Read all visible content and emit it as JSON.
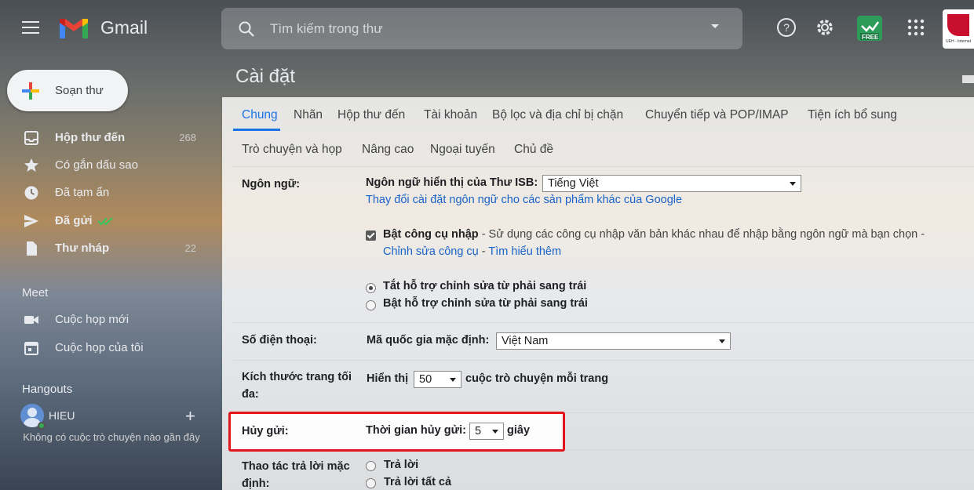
{
  "topbar": {
    "brand": "Gmail",
    "search_placeholder": "Tìm kiếm trong thư",
    "free_label": "FREE",
    "account_caption": "UEH - Internat"
  },
  "compose": {
    "label": "Soạn thư"
  },
  "nav": [
    {
      "label": "Hộp thư đến",
      "count": "268",
      "bold": true,
      "icon": "inbox-icon"
    },
    {
      "label": "Có gắn dấu sao",
      "count": "",
      "bold": false,
      "icon": "star-icon"
    },
    {
      "label": "Đã tạm ẩn",
      "count": "",
      "bold": false,
      "icon": "clock-icon"
    },
    {
      "label": "Đã gửi",
      "count": "",
      "bold": false,
      "icon": "send-icon"
    },
    {
      "label": "Thư nháp",
      "count": "22",
      "bold": true,
      "icon": "draft-icon"
    }
  ],
  "meet": {
    "title": "Meet",
    "items": [
      {
        "label": "Cuộc họp mới",
        "icon": "video-icon"
      },
      {
        "label": "Cuộc họp của tôi",
        "icon": "calendar-icon"
      }
    ]
  },
  "hangouts": {
    "title": "Hangouts",
    "user": "HIEU",
    "empty": "Không có cuộc trò chuyện nào gần đây"
  },
  "settings": {
    "title": "Cài đặt",
    "tabs_row1": [
      "Chung",
      "Nhãn",
      "Hộp thư đến",
      "Tài khoản",
      "Bộ lọc và địa chỉ bị chặn",
      "Chuyển tiếp và POP/IMAP",
      "Tiện ích bổ sung"
    ],
    "tabs_row2": [
      "Trò chuyện và họp",
      "Nâng cao",
      "Ngoại tuyến",
      "Chủ đề"
    ],
    "language": {
      "label": "Ngôn ngữ:",
      "display_label": "Ngôn ngữ hiển thị của Thư ISB:",
      "display_value": "Tiếng Việt",
      "change_link": "Thay đổi cài đặt ngôn ngữ cho các sản phẩm khác của Google",
      "input_tools_label": "Bật công cụ nhập",
      "input_tools_desc": "- Sử dụng các công cụ nhập văn bản khác nhau để nhập bằng ngôn ngữ mà bạn chọn -",
      "edit_tools_link": "Chỉnh sửa công cụ",
      "separator": "-",
      "learn_more_link": "Tìm hiểu thêm",
      "rtl_off": "Tắt hỗ trợ chỉnh sửa từ phải sang trái",
      "rtl_on": "Bật hỗ trợ chỉnh sửa từ phải sang trái"
    },
    "phone": {
      "label": "Số điện thoại:",
      "country_label": "Mã quốc gia mặc định:",
      "country_value": "Việt Nam"
    },
    "page_size": {
      "label_line1": "Kích thước trang tối",
      "label_line2": "đa:",
      "show_label": "Hiển thị",
      "value": "50",
      "suffix": "cuộc trò chuyện mỗi trang"
    },
    "undo_send": {
      "label": "Hủy gửi:",
      "period_label": "Thời gian hủy gửi:",
      "value": "5",
      "unit": "giây"
    },
    "reply": {
      "label_line1": "Thao tác trả lời mặc",
      "label_line2": "định:",
      "opt1": "Trả lời",
      "opt2": "Trả lời tất cả"
    }
  }
}
